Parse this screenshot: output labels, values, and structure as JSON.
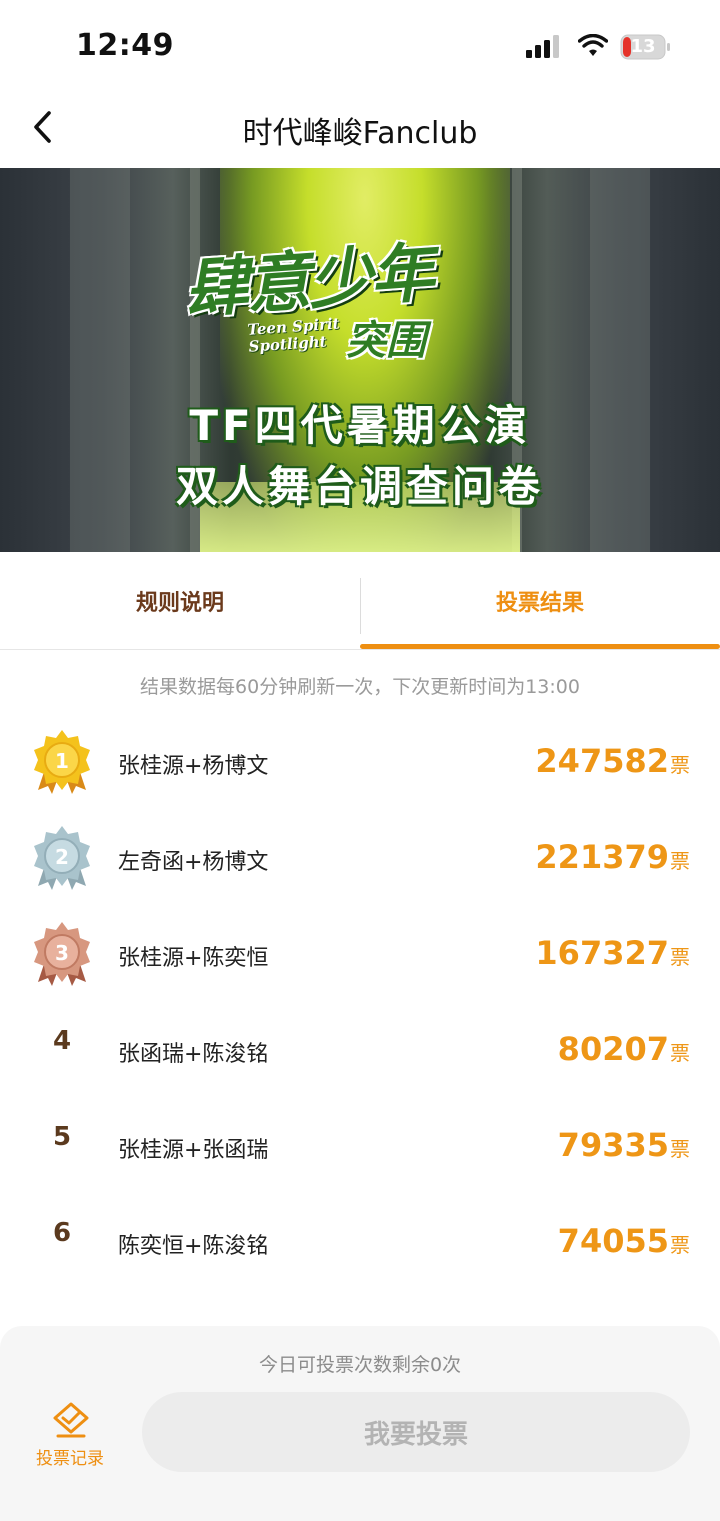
{
  "status_bar": {
    "time": "12:49",
    "battery_level": "13"
  },
  "nav": {
    "title": "时代峰峻Fanclub"
  },
  "banner": {
    "logo_text": "肆意少年",
    "logo_sub": "突围",
    "logo_en_1": "Teen Spirit",
    "logo_en_2": "Spotlight",
    "line1": "TF四代暑期公演",
    "line2": "双人舞台调查问卷"
  },
  "tabs": [
    {
      "label": "规则说明",
      "active": false
    },
    {
      "label": "投票结果",
      "active": true
    }
  ],
  "refresh_note": "结果数据每60分钟刷新一次，下次更新时间为13:00",
  "vote_unit": "票",
  "rankings": [
    {
      "rank": "1",
      "badge": "gold",
      "name": "张桂源+杨博文",
      "votes": "247582"
    },
    {
      "rank": "2",
      "badge": "silver",
      "name": "左奇函+杨博文",
      "votes": "221379"
    },
    {
      "rank": "3",
      "badge": "bronze",
      "name": "张桂源+陈奕恒",
      "votes": "167327"
    },
    {
      "rank": "4",
      "badge": "",
      "name": "张函瑞+陈浚铭",
      "votes": "80207"
    },
    {
      "rank": "5",
      "badge": "",
      "name": "张桂源+张函瑞",
      "votes": "79335"
    },
    {
      "rank": "6",
      "badge": "",
      "name": "陈奕恒+陈浚铭",
      "votes": "74055"
    }
  ],
  "footer": {
    "remaining_note": "今日可投票次数剩余0次",
    "record_label": "投票记录",
    "vote_button_label": "我要投票"
  },
  "colors": {
    "accent": "#ee8f12",
    "rank_text": "#5b3a1e",
    "gold": "#f4c21c",
    "silver": "#a9c3cc",
    "bronze": "#d7977f"
  }
}
